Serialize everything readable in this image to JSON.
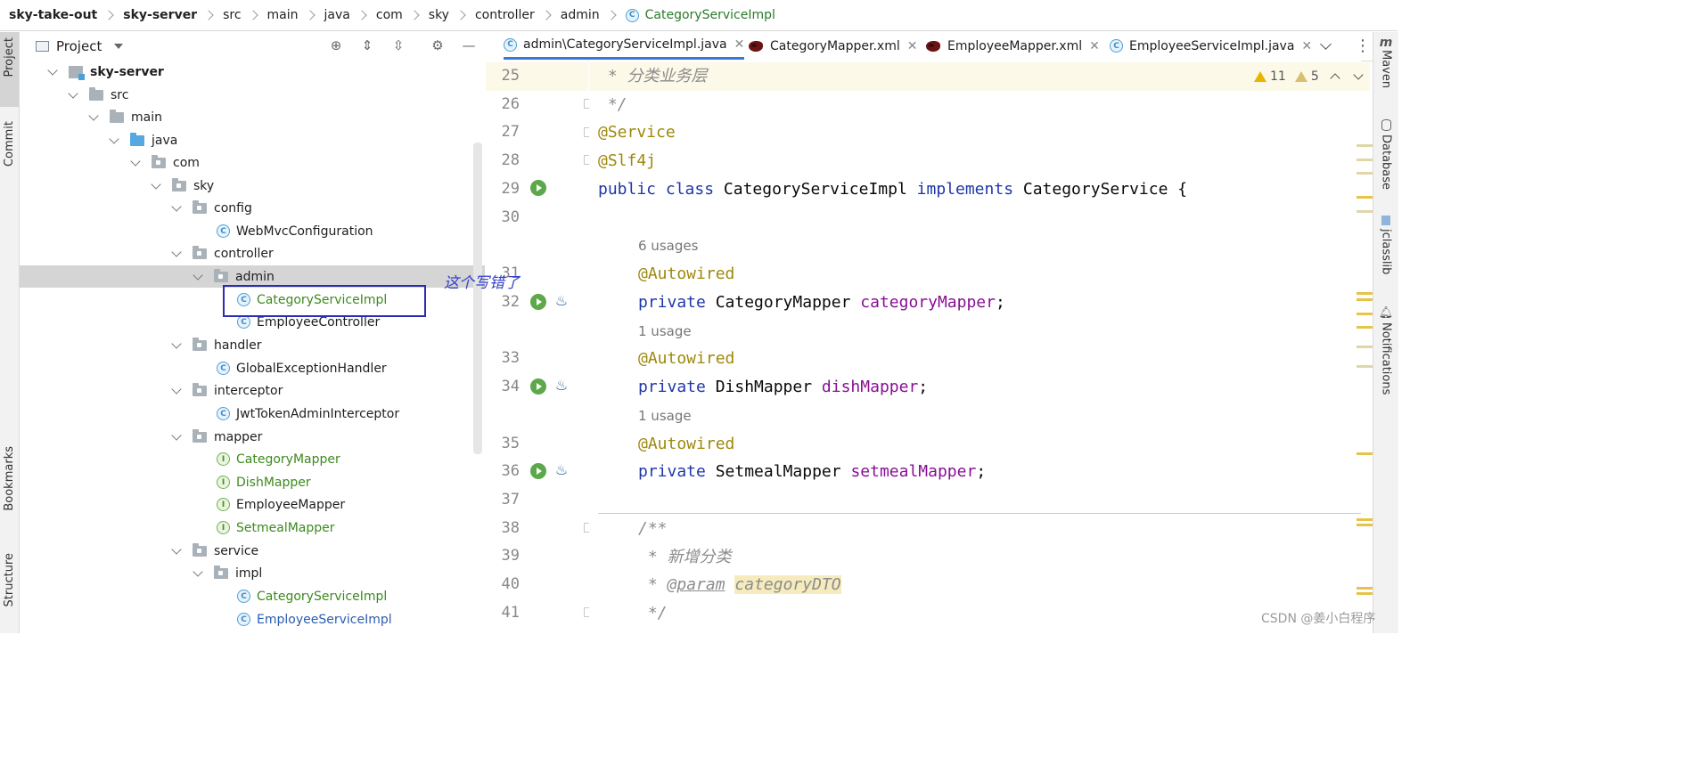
{
  "breadcrumb": [
    "sky-take-out",
    "sky-server",
    "src",
    "main",
    "java",
    "com",
    "sky",
    "controller",
    "admin",
    "CategoryServiceImpl"
  ],
  "project_panel": {
    "title": "Project",
    "tree": [
      {
        "label": "sky-server",
        "level": 1,
        "type": "module",
        "expanded": true
      },
      {
        "label": "src",
        "level": 2,
        "type": "folder",
        "expanded": true
      },
      {
        "label": "main",
        "level": 3,
        "type": "folder",
        "expanded": true
      },
      {
        "label": "java",
        "level": 4,
        "type": "source-folder",
        "expanded": true
      },
      {
        "label": "com",
        "level": 5,
        "type": "package",
        "expanded": true
      },
      {
        "label": "sky",
        "level": 6,
        "type": "package",
        "expanded": true
      },
      {
        "label": "config",
        "level": 7,
        "type": "package",
        "expanded": true
      },
      {
        "label": "WebMvcConfiguration",
        "level": 8,
        "type": "class"
      },
      {
        "label": "controller",
        "level": 7,
        "type": "package",
        "expanded": true
      },
      {
        "label": "admin",
        "level": 8,
        "type": "package",
        "expanded": true,
        "selected": true
      },
      {
        "label": "CategoryServiceImpl",
        "level": 9,
        "type": "class",
        "color": "green"
      },
      {
        "label": "EmployeeController",
        "level": 9,
        "type": "class"
      },
      {
        "label": "handler",
        "level": 7,
        "type": "package",
        "expanded": true
      },
      {
        "label": "GlobalExceptionHandler",
        "level": 8,
        "type": "class"
      },
      {
        "label": "interceptor",
        "level": 7,
        "type": "package",
        "expanded": true
      },
      {
        "label": "JwtTokenAdminInterceptor",
        "level": 8,
        "type": "class"
      },
      {
        "label": "mapper",
        "level": 7,
        "type": "package",
        "expanded": true
      },
      {
        "label": "CategoryMapper",
        "level": 8,
        "type": "interface",
        "color": "green"
      },
      {
        "label": "DishMapper",
        "level": 8,
        "type": "interface",
        "color": "green"
      },
      {
        "label": "EmployeeMapper",
        "level": 8,
        "type": "interface"
      },
      {
        "label": "SetmealMapper",
        "level": 8,
        "type": "interface",
        "color": "green"
      },
      {
        "label": "service",
        "level": 7,
        "type": "package",
        "expanded": true
      },
      {
        "label": "impl",
        "level": 8,
        "type": "package",
        "expanded": true
      },
      {
        "label": "CategoryServiceImpl",
        "level": 9,
        "type": "class",
        "color": "green"
      },
      {
        "label": "EmployeeServiceImpl",
        "level": 9,
        "type": "class",
        "color": "blue"
      }
    ]
  },
  "left_tool_tabs": [
    "Project",
    "Commit",
    "Bookmarks",
    "Structure"
  ],
  "right_tool_tabs": [
    "Maven",
    "Database",
    "jclasslib",
    "Notifications"
  ],
  "editor_tabs": [
    {
      "label": "admin\\CategoryServiceImpl.java",
      "icon": "class-icon",
      "active": true
    },
    {
      "label": "CategoryMapper.xml",
      "icon": "mybatis-icon",
      "active": false
    },
    {
      "label": "EmployeeMapper.xml",
      "icon": "mybatis-icon",
      "active": false
    },
    {
      "label": "EmployeeServiceImpl.java",
      "icon": "class-icon",
      "active": false
    }
  ],
  "close_glyph": "✕",
  "inspections": {
    "warnings": "11",
    "weak_warnings": "5"
  },
  "code_lines": [
    {
      "line": "25",
      "text": " * 分类业务层"
    },
    {
      "line": "26",
      "text": " */"
    },
    {
      "line": "27",
      "text": "@Service"
    },
    {
      "line": "28",
      "text": "@Slf4j"
    },
    {
      "line": "29",
      "text": "public class CategoryServiceImpl implements CategoryService {"
    },
    {
      "line": "30",
      "text": ""
    },
    {
      "line": "",
      "text": "6 usages"
    },
    {
      "line": "31",
      "text": "@Autowired"
    },
    {
      "line": "32",
      "text": "private CategoryMapper categoryMapper;"
    },
    {
      "line": "",
      "text": "1 usage"
    },
    {
      "line": "33",
      "text": "@Autowired"
    },
    {
      "line": "34",
      "text": "private DishMapper dishMapper;"
    },
    {
      "line": "",
      "text": "1 usage"
    },
    {
      "line": "35",
      "text": "@Autowired"
    },
    {
      "line": "36",
      "text": "private SetmealMapper setmealMapper;"
    },
    {
      "line": "37",
      "text": ""
    },
    {
      "line": "38",
      "text": "/**"
    },
    {
      "line": "39",
      "text": " * 新增分类"
    },
    {
      "line": "40",
      "text": " * @param categoryDTO"
    },
    {
      "line": "41",
      "text": " */"
    }
  ],
  "code_tokens": {
    "l25": " * 分类业务层",
    "l26": " */",
    "l27": "@Service",
    "l28": "@Slf4j",
    "l29_kw1": "public",
    "l29_kw2": "class",
    "l29_name": "CategoryServiceImpl",
    "l29_kw3": "implements",
    "l29_iface": "CategoryService {",
    "u6": "6 usages",
    "l31": "@Autowired",
    "l32_kw": "private",
    "l32_type": "CategoryMapper",
    "l32_field": "categoryMapper",
    "l32_semi": ";",
    "u1a": "1 usage",
    "l33": "@Autowired",
    "l34_kw": "private",
    "l34_type": "DishMapper",
    "l34_field": "dishMapper",
    "l34_semi": ";",
    "u1b": "1 usage",
    "l35": "@Autowired",
    "l36_kw": "private",
    "l36_type": "SetmealMapper",
    "l36_field": "setmealMapper",
    "l36_semi": ";",
    "l38": "/**",
    "l39": " * 新增分类",
    "l40_star": " * ",
    "l40_tag": "@param",
    "l40_param": "categoryDTO",
    "l41": " */"
  },
  "annotation_text": "这个写错了",
  "watermark": "CSDN @姜小白程序",
  "colors": {
    "accent": "#3a78d8",
    "annotation_box": "#2b2bb5",
    "keyword": "#1e37a8",
    "annotation": "#9e880d",
    "field": "#871094"
  }
}
